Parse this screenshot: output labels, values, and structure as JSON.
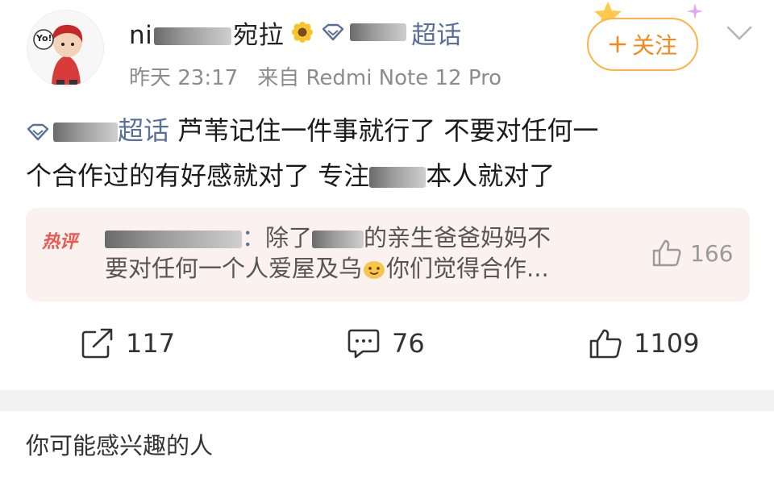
{
  "post": {
    "author": {
      "name_visible_prefix": "ni",
      "name_visible_suffix": "宛拉",
      "topic_suffix": "超话",
      "avatar_text": "Yo!"
    },
    "time": "昨天 23:17",
    "source": "来自 Redmi Note 12 Pro",
    "follow_label": "关注",
    "content": {
      "topic_suffix": "超话",
      "line1_text": " 芦苇记住一件事就行了 不要对任何一",
      "line2_before_blur": "个合作过的有好感就对了 专注",
      "line2_after_blur": "本人就对了"
    },
    "hot_comment": {
      "badge": "热评",
      "user_suffix": "：",
      "text_before": "除了",
      "text_line1_after": "的亲生爸爸妈妈不",
      "text_line2": "要对任何一个人爱屋及乌",
      "text_line2_end": "你们觉得合作...",
      "likes": "166"
    },
    "actions": {
      "repost_count": "117",
      "comment_count": "76",
      "like_count": "1109"
    }
  },
  "recommend_title": "你可能感兴趣的人",
  "colors": {
    "accent_orange": "#f08a1d",
    "topic_blue": "#5a6f9a",
    "hot_red": "#e8584f",
    "hot_bg": "#fbf1ef"
  },
  "icons": [
    "sunflower-icon",
    "diamond-icon",
    "plus-icon",
    "chevron-down-icon",
    "thumb-up-icon",
    "repost-icon",
    "comment-icon",
    "emoji-icon"
  ]
}
